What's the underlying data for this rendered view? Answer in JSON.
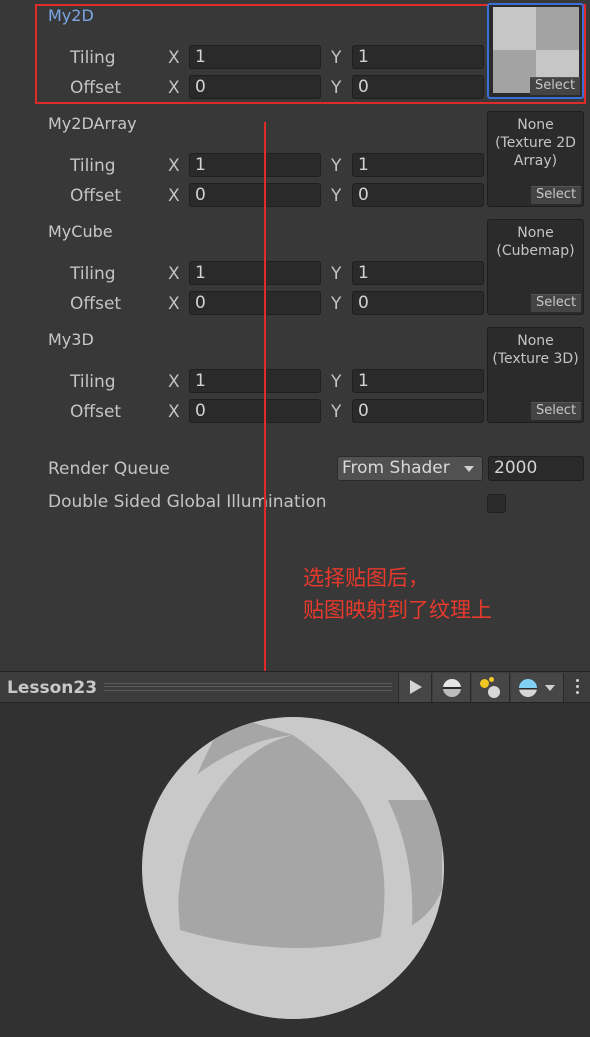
{
  "properties": [
    {
      "name": "My2D",
      "tiling_label": "Tiling",
      "offset_label": "Offset",
      "tiling_x": "1",
      "tiling_y": "1",
      "offset_x": "0",
      "offset_y": "0",
      "texture_none": "",
      "select_label": "Select"
    },
    {
      "name": "My2DArray",
      "tiling_label": "Tiling",
      "offset_label": "Offset",
      "tiling_x": "1",
      "tiling_y": "1",
      "offset_x": "0",
      "offset_y": "0",
      "texture_none": "None\n(Texture 2D\nArray)",
      "select_label": "Select"
    },
    {
      "name": "MyCube",
      "tiling_label": "Tiling",
      "offset_label": "Offset",
      "tiling_x": "1",
      "tiling_y": "1",
      "offset_x": "0",
      "offset_y": "0",
      "texture_none": "None\n(Cubemap)",
      "select_label": "Select"
    },
    {
      "name": "My3D",
      "tiling_label": "Tiling",
      "offset_label": "Offset",
      "tiling_x": "1",
      "tiling_y": "1",
      "offset_x": "0",
      "offset_y": "0",
      "texture_none": "None\n(Texture 3D)",
      "select_label": "Select"
    }
  ],
  "axis": {
    "x": "X",
    "y": "Y"
  },
  "render_queue": {
    "label": "Render Queue",
    "dropdown_value": "From Shader",
    "value": "2000"
  },
  "double_sided_gi": {
    "label": "Double Sided Global Illumination",
    "checked": false
  },
  "annotation": {
    "line1": "选择贴图后，",
    "line2": "贴图映射到了纹理上",
    "color": "#e8392c"
  },
  "preview": {
    "title": "Lesson23"
  },
  "icons": [
    "play-icon",
    "sphere-icon",
    "light-icon",
    "skybox-icon",
    "more-icon"
  ]
}
